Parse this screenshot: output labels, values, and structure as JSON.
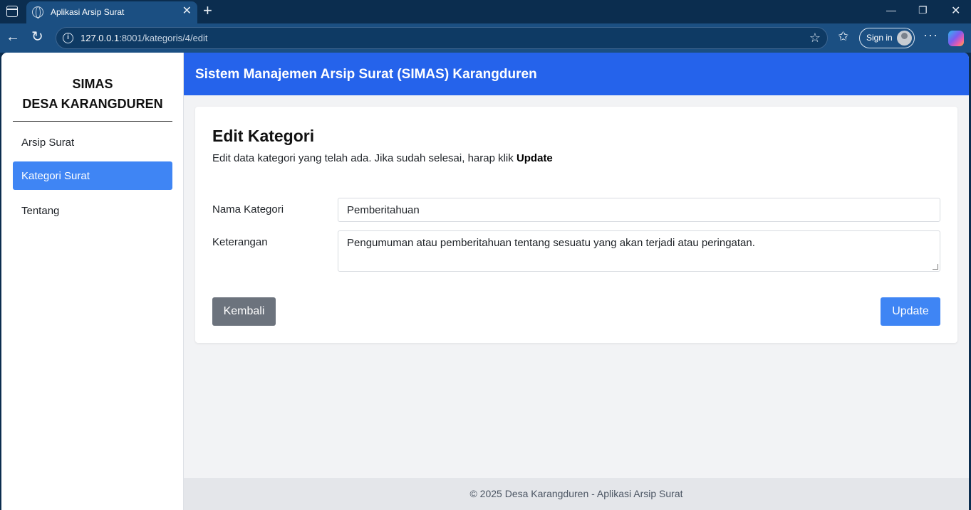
{
  "browser": {
    "tab_title": "Aplikasi Arsip Surat",
    "url_host": "127.0.0.1",
    "url_rest": ":8001/kategoris/4/edit",
    "sign_in_label": "Sign in"
  },
  "sidebar": {
    "brand_line1": "SIMAS",
    "brand_line2": "DESA KARANGDUREN",
    "items": [
      {
        "label": "Arsip Surat"
      },
      {
        "label": "Kategori Surat",
        "active": true
      },
      {
        "label": "Tentang"
      }
    ]
  },
  "header": {
    "title": "Sistem Manajemen Arsip Surat (SIMAS) Karangduren"
  },
  "form": {
    "heading": "Edit Kategori",
    "description": "Edit data kategori yang telah ada. Jika sudah selesai, harap klik",
    "description_bold": "Update",
    "nama_label": "Nama Kategori",
    "nama_value": "Pemberitahuan",
    "keterangan_label": "Keterangan",
    "keterangan_value": "Pengumuman atau pemberitahuan tentang sesuatu yang akan terjadi atau peringatan.",
    "back_label": "Kembali",
    "update_label": "Update"
  },
  "footer": {
    "text": "© 2025 Desa Karangduren - Aplikasi Arsip Surat"
  },
  "colors": {
    "primary": "#2563eb",
    "active_menu": "#3f85f4",
    "secondary_button": "#6c737d"
  }
}
